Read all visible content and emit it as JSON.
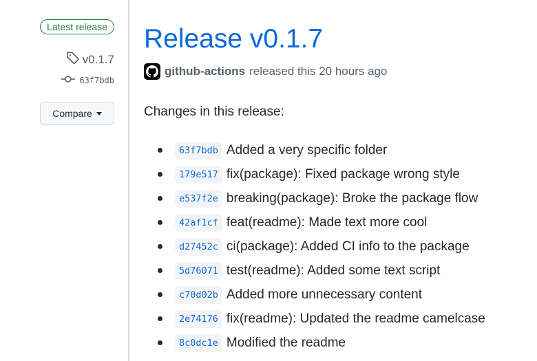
{
  "sidebar": {
    "latest_badge": "Latest release",
    "tag": {
      "icon": "tag-icon",
      "label": "v0.1.7"
    },
    "commit": {
      "icon": "git-commit-icon",
      "sha": "63f7bdb"
    },
    "compare_button": {
      "label": "Compare",
      "icon": "caret-down-icon"
    }
  },
  "release": {
    "title": "Release v0.1.7",
    "author": "github-actions",
    "author_avatar_icon": "github-mark-icon",
    "released_text": "released this 20 hours ago"
  },
  "changes": {
    "heading": "Changes in this release:",
    "commits": [
      {
        "sha": "63f7bdb",
        "message": "Added a very specific folder"
      },
      {
        "sha": "179e517",
        "message": "fix(package): Fixed package wrong style"
      },
      {
        "sha": "e537f2e",
        "message": "breaking(package): Broke the package flow"
      },
      {
        "sha": "42af1cf",
        "message": "feat(readme): Made text more cool"
      },
      {
        "sha": "d27452c",
        "message": "ci(package): Added CI info to the package"
      },
      {
        "sha": "5d76071",
        "message": "test(readme): Added some text script"
      },
      {
        "sha": "c70d02b",
        "message": "Added more unnecessary content"
      },
      {
        "sha": "2e74176",
        "message": "fix(readme): Updated the readme camelcase"
      },
      {
        "sha": "8c0dc1e",
        "message": "Modified the readme"
      }
    ]
  },
  "colors": {
    "link_blue": "#0969da",
    "success_green": "#1a7f37",
    "muted_text": "#57606a",
    "code_bg": "#f3f4f6"
  }
}
